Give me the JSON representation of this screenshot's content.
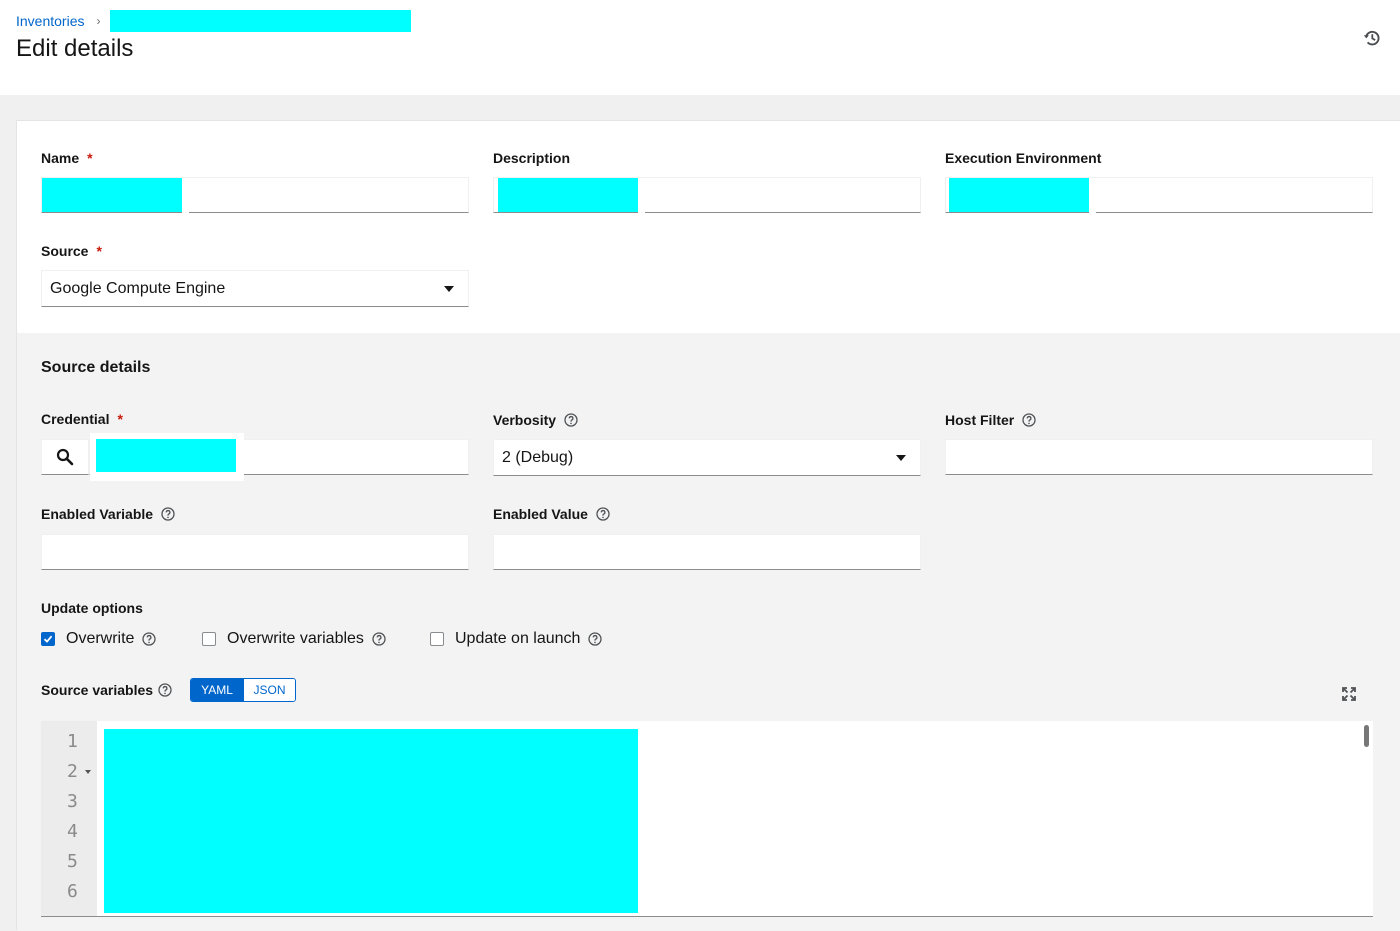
{
  "breadcrumb": {
    "parent": "Inventories",
    "separator": "›"
  },
  "page": {
    "title": "Edit details"
  },
  "icons": {
    "history": "history-icon",
    "help": "question-circle-icon",
    "search": "search-icon",
    "expand": "expand-icon",
    "caret": "caret-down-icon"
  },
  "colors": {
    "accent": "#0066cc",
    "required": "#c9190b",
    "redaction": "#00ffff"
  },
  "form": {
    "name_label": "Name",
    "description_label": "Description",
    "ee_label": "Execution Environment",
    "source_label": "Source",
    "source_value": "Google Compute Engine",
    "required_mark": "*"
  },
  "source_details": {
    "title": "Source details",
    "credential_label": "Credential",
    "verbosity_label": "Verbosity",
    "verbosity_value": "2 (Debug)",
    "host_filter_label": "Host Filter",
    "host_filter_value": "",
    "enabled_variable_label": "Enabled Variable",
    "enabled_variable_value": "",
    "enabled_value_label": "Enabled Value",
    "enabled_value_value": "",
    "update_options_label": "Update options",
    "options": [
      {
        "label": "Overwrite",
        "checked": true
      },
      {
        "label": "Overwrite variables",
        "checked": false
      },
      {
        "label": "Update on launch",
        "checked": false
      }
    ],
    "source_variables_label": "Source variables",
    "format_toggle": {
      "yaml": "YAML",
      "json": "JSON",
      "selected": "YAML"
    },
    "line_numbers": [
      "1",
      "2",
      "3",
      "4",
      "5",
      "6"
    ]
  }
}
